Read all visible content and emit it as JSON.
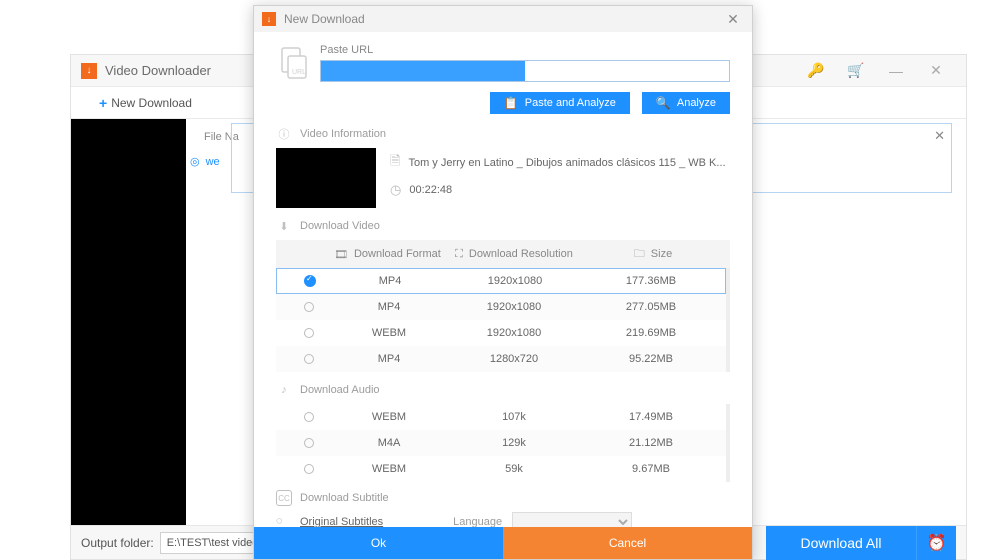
{
  "app": {
    "title": "Video Downloader",
    "new_download": "New Download",
    "file_name_label": "File Na",
    "we_label": "we",
    "output_folder_label": "Output folder:",
    "output_folder_value": "E:\\TEST\\test video outpu",
    "download_all": "Download All"
  },
  "dialog": {
    "title": "New Download",
    "paste_label": "Paste URL",
    "url_value": "████████████████████████",
    "paste_analyze": "Paste and Analyze",
    "analyze": "Analyze",
    "section_video_info": "Video Information",
    "video": {
      "title": "Tom y Jerry en Latino _ Dibujos animados clásicos 115 _ WB K...",
      "duration": "00:22:48"
    },
    "section_download_video": "Download Video",
    "columns": {
      "format": "Download Format",
      "resolution": "Download Resolution",
      "size": "Size"
    },
    "video_formats": [
      {
        "format": "MP4",
        "resolution": "1920x1080",
        "size": "177.36MB",
        "selected": true
      },
      {
        "format": "MP4",
        "resolution": "1920x1080",
        "size": "277.05MB",
        "selected": false
      },
      {
        "format": "WEBM",
        "resolution": "1920x1080",
        "size": "219.69MB",
        "selected": false
      },
      {
        "format": "MP4",
        "resolution": "1280x720",
        "size": "95.22MB",
        "selected": false
      }
    ],
    "section_download_audio": "Download Audio",
    "audio_formats": [
      {
        "format": "WEBM",
        "resolution": "107k",
        "size": "17.49MB",
        "selected": false
      },
      {
        "format": "M4A",
        "resolution": "129k",
        "size": "21.12MB",
        "selected": false
      },
      {
        "format": "WEBM",
        "resolution": "59k",
        "size": "9.67MB",
        "selected": false
      }
    ],
    "section_download_subtitle": "Download Subtitle",
    "original_subtitles": "Original Subtitles",
    "language_label": "Language",
    "ok": "Ok",
    "cancel": "Cancel"
  }
}
